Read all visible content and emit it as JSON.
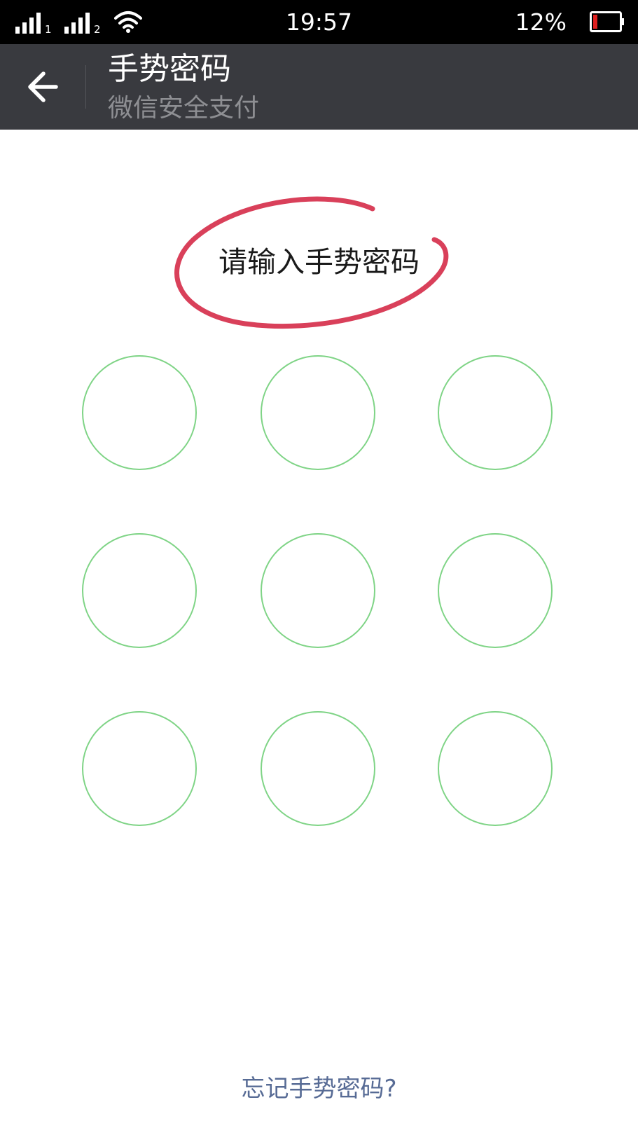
{
  "status_bar": {
    "time": "19:57",
    "battery_percent": "12%",
    "battery_level": 0.12,
    "sim1_label": "1",
    "sim2_label": "2",
    "icons": [
      "signal-icon",
      "signal-icon",
      "wifi-icon",
      "battery-icon"
    ]
  },
  "header": {
    "back_icon": "arrow-left-icon",
    "title": "手势密码",
    "subtitle": "微信安全支付"
  },
  "gesture": {
    "prompt": "请输入手势密码",
    "dots": [
      1,
      2,
      3,
      4,
      5,
      6,
      7,
      8,
      9
    ]
  },
  "footer": {
    "forgot_link": "忘记手势密码?"
  },
  "colors": {
    "status_bar": "#000000",
    "title_bar": "#393a3f",
    "dot_ring": "#7fd486",
    "link": "#576b95",
    "highlight_ring": "#d9405a",
    "battery_low": "#e02020"
  }
}
